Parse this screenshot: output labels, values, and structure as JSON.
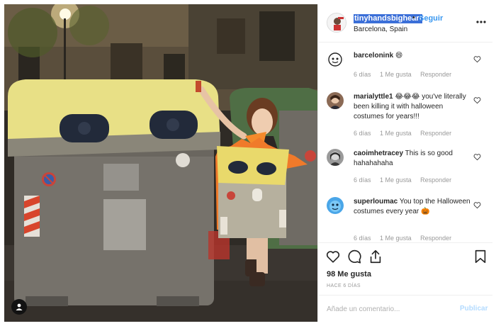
{
  "post": {
    "username": "tinyhandsbigheart",
    "separator": "•",
    "follow_label": "Seguir",
    "location": "Barcelona, Spain",
    "more_icon": "ellipsis-icon"
  },
  "comments": [
    {
      "user": "barcelonink",
      "text": "😄",
      "time": "6 días",
      "likes": "1 Me gusta",
      "reply": "Responder"
    },
    {
      "user": "marialyttle1",
      "text": "😂😂😂 you've literally been killing it with halloween costumes for years!!!",
      "time": "6 días",
      "likes": "1 Me gusta",
      "reply": "Responder"
    },
    {
      "user": "caoimhetracey",
      "text": "This is so good hahahahaha",
      "time": "6 días",
      "likes": "1 Me gusta",
      "reply": "Responder"
    },
    {
      "user": "superloumac",
      "text": "You top the Halloween costumes every year 🎃",
      "time": "6 días",
      "likes": "1 Me gusta",
      "reply": "Responder"
    }
  ],
  "actions": {
    "icons": [
      "heart-icon",
      "comment-icon",
      "share-icon",
      "bookmark-icon"
    ],
    "likes_count": "98 Me gusta",
    "posted_ago": "HACE 6 DÍAS"
  },
  "composer": {
    "placeholder": "Añade un comentario...",
    "publish_label": "Publicar"
  },
  "colors": {
    "link_blue": "#3897f0",
    "publish_disabled": "#b3dbff",
    "username_highlight": "#3b6fd8",
    "border": "#efefef"
  }
}
